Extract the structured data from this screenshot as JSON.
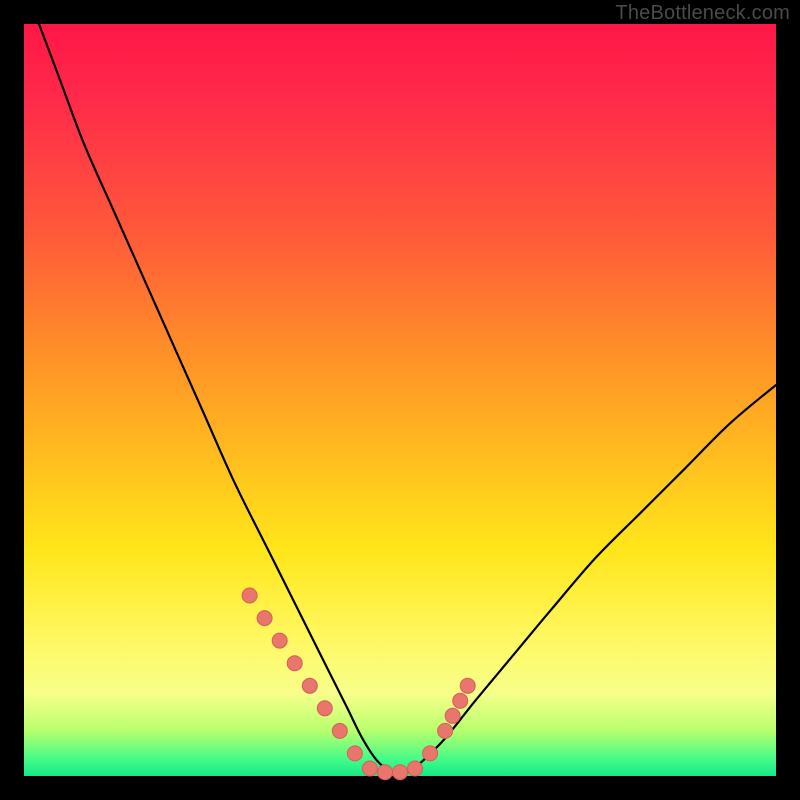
{
  "attribution": "TheBottleneck.com",
  "colors": {
    "frame": "#000000",
    "curve": "#000000",
    "marker_fill": "#e8766d",
    "marker_stroke": "#d85e56",
    "gradient_top": "#ff1747",
    "gradient_bottom": "#16e689"
  },
  "chart_data": {
    "type": "line",
    "title": "",
    "xlabel": "",
    "ylabel": "",
    "xlim": [
      0,
      100
    ],
    "ylim": [
      0,
      100
    ],
    "series": [
      {
        "name": "bottleneck-curve",
        "x": [
          2,
          5,
          8,
          12,
          16,
          20,
          24,
          28,
          32,
          36,
          40,
          43,
          45,
          47,
          49,
          51,
          53,
          56,
          60,
          65,
          70,
          76,
          82,
          88,
          94,
          100
        ],
        "y": [
          100,
          92,
          84,
          75,
          66,
          57,
          48,
          39,
          31,
          23,
          15,
          9,
          5,
          2,
          0.5,
          0.5,
          2,
          5,
          10,
          16,
          22,
          29,
          35,
          41,
          47,
          52
        ]
      }
    ],
    "markers": {
      "name": "highlighted-points",
      "x": [
        30,
        32,
        34,
        36,
        38,
        40,
        42,
        44,
        46,
        48,
        50,
        52,
        54,
        56,
        57,
        58,
        59
      ],
      "y": [
        24,
        21,
        18,
        15,
        12,
        9,
        6,
        3,
        1,
        0.5,
        0.5,
        1,
        3,
        6,
        8,
        10,
        12
      ]
    }
  }
}
